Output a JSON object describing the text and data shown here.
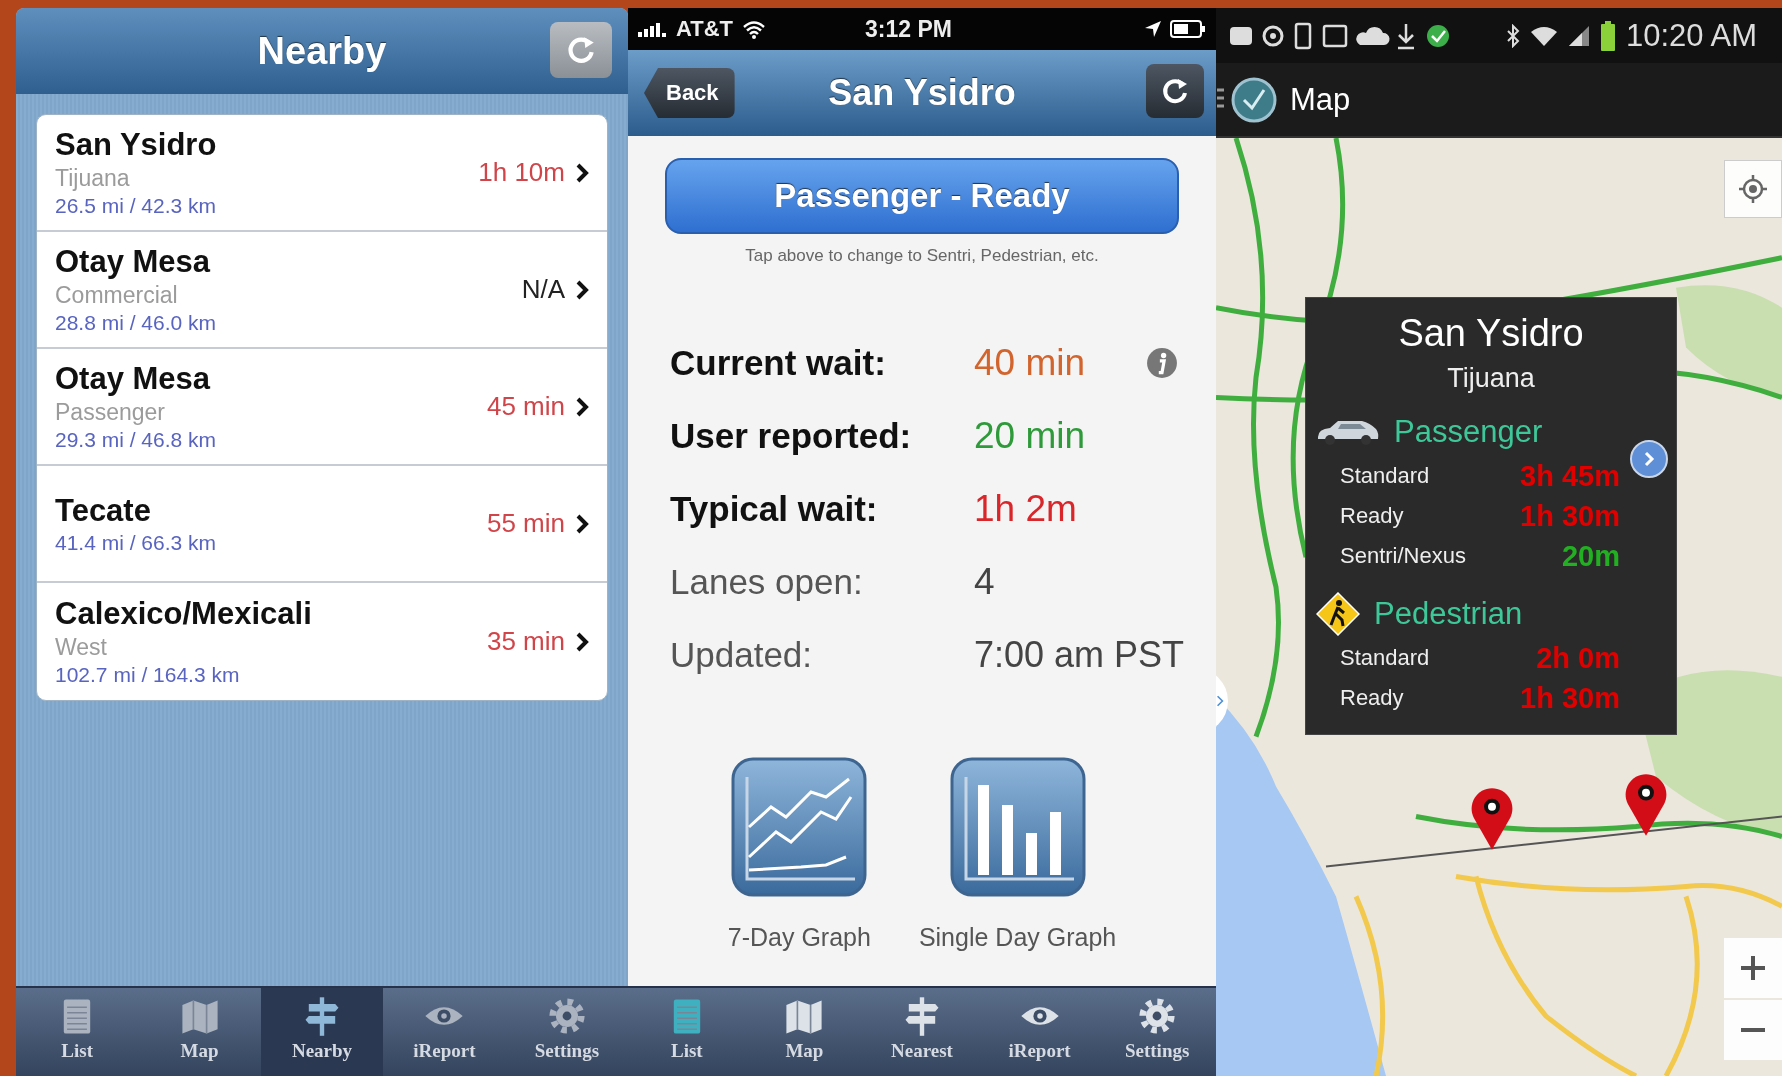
{
  "nearby": {
    "title": "Nearby",
    "crossings": [
      {
        "name": "San Ysidro",
        "type": "Tijuana",
        "distance": "26.5 mi / 42.3 km",
        "wait": "1h 10m",
        "color": "#d0454a"
      },
      {
        "name": "Otay Mesa",
        "type": "Commercial",
        "distance": "28.8 mi / 46.0 km",
        "wait": "N/A",
        "color": "#222222"
      },
      {
        "name": "Otay Mesa",
        "type": "Passenger",
        "distance": "29.3 mi / 46.8 km",
        "wait": "45 min",
        "color": "#d0454a"
      },
      {
        "name": "Tecate",
        "distance": "41.4 mi / 66.3 km",
        "wait": "55 min",
        "color": "#d0454a"
      },
      {
        "name": "Calexico/Mexicali",
        "type": "West",
        "distance": "102.7 mi / 164.3 km",
        "wait": "35 min",
        "color": "#d0454a"
      }
    ],
    "tab_bar": [
      {
        "label": "List",
        "kind": "list",
        "selected": false
      },
      {
        "label": "Map",
        "kind": "map",
        "selected": false
      },
      {
        "label": "Nearby",
        "kind": "signpost",
        "selected": true
      },
      {
        "label": "iReport",
        "kind": "eye",
        "selected": false
      },
      {
        "label": "Settings",
        "kind": "gear",
        "selected": false
      }
    ]
  },
  "detail": {
    "status_bar": {
      "carrier": "AT&T",
      "time": "3:12 PM"
    },
    "back": "Back",
    "title": "San Ysidro",
    "mode_button": "Passenger - Ready",
    "hint": "Tap above to change to Sentri, Pedestrian, etc.",
    "stats": [
      {
        "label": "Current wait:",
        "value": "40 min",
        "color": "#d2652e",
        "emphasis": true,
        "info": true
      },
      {
        "label": "User reported:",
        "value": "20 min",
        "color": "#2e9a3a",
        "emphasis": true,
        "info": false
      },
      {
        "label": "Typical wait:",
        "value": "1h 2m",
        "color": "#d8262a",
        "emphasis": true,
        "info": false
      },
      {
        "label": "Lanes open:",
        "value": "4",
        "color": "#444444",
        "emphasis": false,
        "info": false
      },
      {
        "label": "Updated:",
        "value": "7:00 am PST",
        "color": "#444444",
        "emphasis": false,
        "info": false
      }
    ],
    "graphs": [
      {
        "label": "7-Day Graph",
        "kind": "line"
      },
      {
        "label": "Single Day Graph",
        "kind": "bar"
      }
    ],
    "tab_bar": [
      {
        "label": "List",
        "kind": "list",
        "selected": true
      },
      {
        "label": "Map",
        "kind": "map",
        "selected": false
      },
      {
        "label": "Nearest",
        "kind": "signpost",
        "selected": false
      },
      {
        "label": "iReport",
        "kind": "eye",
        "selected": false
      },
      {
        "label": "Settings",
        "kind": "gear",
        "selected": false
      }
    ]
  },
  "map_screen": {
    "status_bar": {
      "time": "10:20 AM"
    },
    "title": "Map",
    "popup": {
      "title": "San Ysidro",
      "subtitle": "Tijuana",
      "sections": [
        {
          "kind": "car",
          "name": "Passenger",
          "rows": [
            {
              "label": "Standard",
              "value": "3h 45m",
              "color": "#e00000"
            },
            {
              "label": "Ready",
              "value": "1h 30m",
              "color": "#e00000"
            },
            {
              "label": "Sentri/Nexus",
              "value": "20m",
              "color": "#22b022"
            }
          ]
        },
        {
          "kind": "pedestrian",
          "name": "Pedestrian",
          "rows": [
            {
              "label": "Standard",
              "value": "2h 0m",
              "color": "#e00000"
            },
            {
              "label": "Ready",
              "value": "1h 30m",
              "color": "#e00000"
            }
          ]
        }
      ]
    }
  }
}
